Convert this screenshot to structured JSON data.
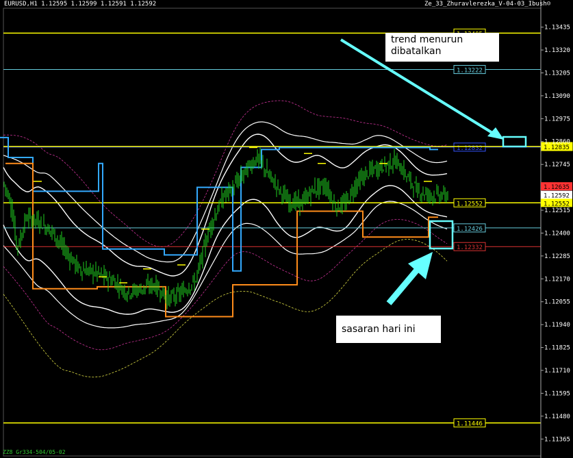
{
  "header": {
    "symbol_info": "EURUSD,H1  1.12595 1.12599 1.12591 1.12592",
    "indicator_name": "Ze_33_Zhuravlerezka_V-04-03_Ibush",
    "smiley": "☺"
  },
  "footer": {
    "text": "ZZ8 Gr334-504/05-02"
  },
  "annotations": {
    "trend_note": "trend menurun dibatalkan",
    "target_note": "sasaran hari ini"
  },
  "colors": {
    "background": "#000000",
    "candles": "#1fd01f",
    "yellow_levels": "#ffff00",
    "blue_channel": "#33aaff",
    "orange_channel": "#ff8c1a",
    "bands": "#ffffff",
    "cyan_annotation": "#66ffff",
    "current_price_label": "#ff3333"
  },
  "chart_data": {
    "type": "candlestick",
    "title": "",
    "symbol": "EURUSD",
    "timeframe": "H1",
    "ohlc": {
      "open": 1.12595,
      "high": 1.12599,
      "low": 1.12591,
      "close": 1.12592
    },
    "ylim": [
      1.1128,
      1.1355
    ],
    "y_ticks": [
      "1.13435",
      "1.13320",
      "1.13205",
      "1.13090",
      "1.12975",
      "1.12860",
      "1.12745",
      "1.12630",
      "1.12515",
      "1.12400",
      "1.12285",
      "1.12170",
      "1.12055",
      "1.11940",
      "1.11825",
      "1.11710",
      "1.11595",
      "1.11480",
      "1.11365"
    ],
    "horizontal_levels": [
      {
        "label": "1.13405",
        "value": 1.13405,
        "color": "#ffff00"
      },
      {
        "label": "1.13222",
        "value": 1.13222,
        "color": "#66ccdd"
      },
      {
        "label": "1.12832",
        "value": 1.12832,
        "color": "#3355ff"
      },
      {
        "label": "1.12835",
        "value": 1.12835,
        "color": "#ffff00"
      },
      {
        "label": "1.12552",
        "value": 1.12552,
        "color": "#ffff00"
      },
      {
        "label": "1.12426",
        "value": 1.12426,
        "color": "#66ccdd"
      },
      {
        "label": "1.12332",
        "value": 1.12332,
        "color": "#dd3333"
      },
      {
        "label": "1.11446",
        "value": 1.11446,
        "color": "#ffff00"
      }
    ],
    "axis_price_labels": [
      {
        "label": "1.12635",
        "value": 1.12635,
        "bg": "#ff3333"
      },
      {
        "label": "1.12592",
        "value": 1.12592,
        "bg": "#ffffff"
      },
      {
        "label": "1.12552",
        "value": 1.12552,
        "bg": "#ffff00"
      }
    ],
    "blue_channel": [
      [
        0,
        1.1288
      ],
      [
        12,
        1.1288
      ],
      [
        12,
        1.1278
      ],
      [
        48,
        1.1278
      ],
      [
        48,
        1.1261
      ],
      [
        144,
        1.1261
      ],
      [
        144,
        1.1275
      ],
      [
        150,
        1.1275
      ],
      [
        150,
        1.1232
      ],
      [
        240,
        1.1232
      ],
      [
        240,
        1.1229
      ],
      [
        288,
        1.1229
      ],
      [
        288,
        1.1263
      ],
      [
        340,
        1.1263
      ],
      [
        340,
        1.1221
      ],
      [
        352,
        1.1221
      ],
      [
        352,
        1.1273
      ],
      [
        382,
        1.1273
      ],
      [
        382,
        1.1282
      ],
      [
        408,
        1.1282
      ],
      [
        408,
        1.1283
      ],
      [
        628,
        1.1283
      ],
      [
        628,
        1.1282
      ],
      [
        640,
        1.1282
      ]
    ],
    "orange_channel": [
      [
        8,
        1.1275
      ],
      [
        48,
        1.1275
      ],
      [
        48,
        1.1212
      ],
      [
        142,
        1.1212
      ],
      [
        142,
        1.1213
      ],
      [
        242,
        1.1213
      ],
      [
        242,
        1.1198
      ],
      [
        340,
        1.1198
      ],
      [
        340,
        1.1214
      ],
      [
        434,
        1.1214
      ],
      [
        434,
        1.1251
      ],
      [
        530,
        1.1251
      ],
      [
        530,
        1.1238
      ],
      [
        626,
        1.1238
      ],
      [
        626,
        1.1248
      ],
      [
        640,
        1.1248
      ]
    ],
    "close_path": [
      [
        5,
        1.1265
      ],
      [
        15,
        1.1256
      ],
      [
        25,
        1.1232
      ],
      [
        38,
        1.1248
      ],
      [
        55,
        1.1246
      ],
      [
        75,
        1.1241
      ],
      [
        95,
        1.1231
      ],
      [
        115,
        1.1222
      ],
      [
        140,
        1.122
      ],
      [
        165,
        1.1216
      ],
      [
        185,
        1.121
      ],
      [
        205,
        1.1212
      ],
      [
        225,
        1.1214
      ],
      [
        245,
        1.1207
      ],
      [
        265,
        1.121
      ],
      [
        285,
        1.1216
      ],
      [
        305,
        1.1242
      ],
      [
        325,
        1.1258
      ],
      [
        345,
        1.1265
      ],
      [
        360,
        1.1272
      ],
      [
        375,
        1.1278
      ],
      [
        392,
        1.1269
      ],
      [
        405,
        1.1263
      ],
      [
        420,
        1.1256
      ],
      [
        440,
        1.1255
      ],
      [
        458,
        1.1262
      ],
      [
        475,
        1.1264
      ],
      [
        490,
        1.1253
      ],
      [
        505,
        1.1255
      ],
      [
        520,
        1.1265
      ],
      [
        540,
        1.1271
      ],
      [
        560,
        1.1274
      ],
      [
        578,
        1.1276
      ],
      [
        595,
        1.1268
      ],
      [
        610,
        1.1261
      ],
      [
        630,
        1.1259
      ],
      [
        650,
        1.1259
      ]
    ]
  }
}
